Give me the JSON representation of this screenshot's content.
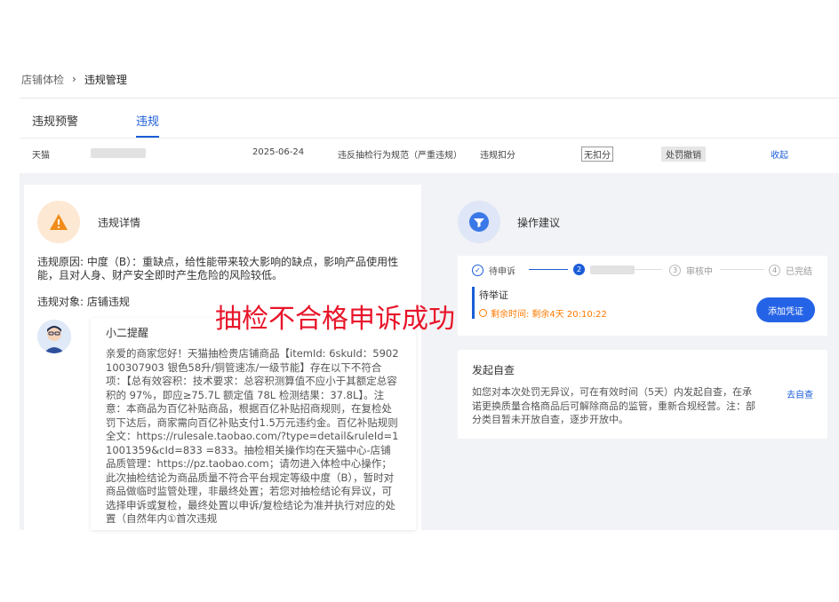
{
  "breadcrumb": {
    "parent": "店铺体检",
    "separator": "›",
    "current": "违规管理"
  },
  "tabs": [
    {
      "label": "违规预警"
    },
    {
      "label": "违规"
    }
  ],
  "summary": {
    "platform": "天猫",
    "date": "2025-06-24",
    "violation_type": "违反抽检行为规范（严重违规）",
    "penalty": "违规扣分",
    "deduction_status": "无扣分",
    "action_status": "处罚撤销",
    "collapse_link": "收起"
  },
  "detail": {
    "title": "违规详情",
    "reason_label": "违规原因:",
    "reason_text": "中度（B）：重缺点，给性能带来较大影响的缺点，影响产品使用性能，且对人身、财产安全即时产生危险的风险较低。",
    "target_label": "违规对象:",
    "target_text": "店铺违规"
  },
  "message": {
    "sender": "小二提醒",
    "body": "亲爱的商家您好！天猫抽检贵店铺商品【itemId:               6skuId：5902100307903 银色58升/铜管速冻/一级节能】存在以下不符合项：【总有效容积：技术要求：总容积测算值不应小于其额定总容积的 97%，即应≥75.7L 额定值 78L 检测结果：37.8L】。注意：本商品为百亿补贴商品，根据百亿补贴招商规则，在复检处罚下达后，商家需向百亿补贴支付1.5万元违约金。百亿补贴规则全文：https://rulesale.taobao.com/?type=detail&ruleId=11001359&cId=833                =833。抽检相关操作均在天猫中心-店铺品质管理：https://pz.taobao.com；请勿进入体检中心操作；此次抽检结论为商品质量不符合平台规定等级中度（B），暂时对商品做临时监管处理，非最终处置；若您对抽检结论有异议，可选择申诉或复检，最终处置以申诉/复检结论为准并执行对应的处置（自然年内①首次违规"
  },
  "advice": {
    "title": "操作建议",
    "steps": [
      {
        "num": "✓",
        "label": "待申诉"
      },
      {
        "num": "2",
        "label": ""
      },
      {
        "num": "3",
        "label": "审核中"
      },
      {
        "num": "4",
        "label": "已完结"
      }
    ],
    "task_title": "待举证",
    "time_label": "剩余时间:",
    "time_value": "剩余4天 20:10:22",
    "add_button": "添加凭证"
  },
  "self_check": {
    "title": "发起自查",
    "desc": "如您对本次处罚无异议，可在有效时间（5天）内发起自查，在承诺更换质量合格商品后可解除商品的监管，重新合规经营。注：部分类目暂未开放自查，逐步开放中。",
    "link": "去自查"
  },
  "overlay_text": "抽检不合格申诉成功",
  "colors": {
    "accent": "#1a5dd8",
    "warning": "#ff7a00",
    "overlay": "#e8152a"
  }
}
